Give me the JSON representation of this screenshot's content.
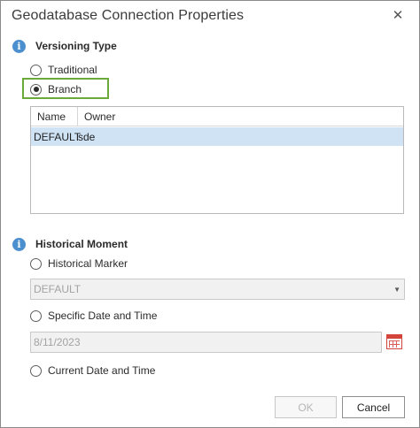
{
  "dialog": {
    "title": "Geodatabase Connection Properties",
    "close_glyph": "✕"
  },
  "versioning": {
    "icon": "info-icon",
    "heading": "Versioning Type",
    "options": [
      {
        "label": "Traditional",
        "checked": false
      },
      {
        "label": "Branch",
        "checked": true
      }
    ],
    "highlight_color": "#6aaa3a",
    "table": {
      "columns": [
        "Name",
        "Owner"
      ],
      "rows": [
        {
          "name": "DEFAULT",
          "owner": "sde",
          "selected": true
        }
      ]
    }
  },
  "historical": {
    "icon": "info-icon",
    "heading": "Historical Moment",
    "marker_label": "Historical Marker",
    "marker_value": "DEFAULT",
    "date_label": "Specific Date and Time",
    "date_value": "8/11/2023",
    "current_label": "Current Date and Time",
    "calendar_icon": "calendar-icon"
  },
  "buttons": {
    "ok": "OK",
    "cancel": "Cancel"
  },
  "colors": {
    "accent": "#4c8fce",
    "selection": "#cfe3f5",
    "calendar": "#d3453b"
  }
}
